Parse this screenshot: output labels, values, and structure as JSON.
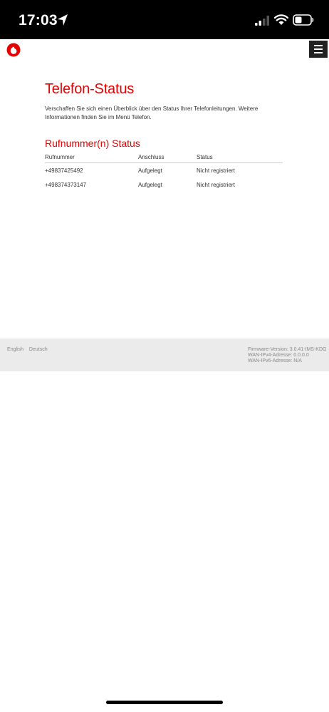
{
  "status_bar": {
    "time": "17:03",
    "icons": [
      "location-arrow-icon",
      "cellular-signal-icon",
      "wifi-icon",
      "battery-icon"
    ]
  },
  "header": {
    "logo": "vodafone-logo",
    "menu_icon": "hamburger-menu-icon"
  },
  "main": {
    "title": "Telefon-Status",
    "intro": "Verschaffen Sie sich einen Überblick über den Status Ihrer Telefonleitungen. Weitere Informationen finden Sie im Menü Telefon.",
    "section_title": "Rufnummer(n) Status",
    "table": {
      "headers": [
        "Rufnummer",
        "Anschluss",
        "Status"
      ],
      "rows": [
        [
          "+49837425492",
          "Aufgelegt",
          "Nicht registriert"
        ],
        [
          "+498374373147",
          "Aufgelegt",
          "Nicht registriert"
        ]
      ]
    }
  },
  "footer": {
    "languages": [
      "English",
      "Deutsch"
    ],
    "firmware": "Firmware-Version: 3.0.41-IMS-KDG",
    "wan_ipv4": "WAN-IPv4-Adresse: 0.0.0.0",
    "wan_ipv6": "WAN-IPv6-Adresse: N/A"
  },
  "colors": {
    "accent": "#e60000",
    "footer_bg": "#ebebeb",
    "status_bar_bg": "#000000"
  }
}
